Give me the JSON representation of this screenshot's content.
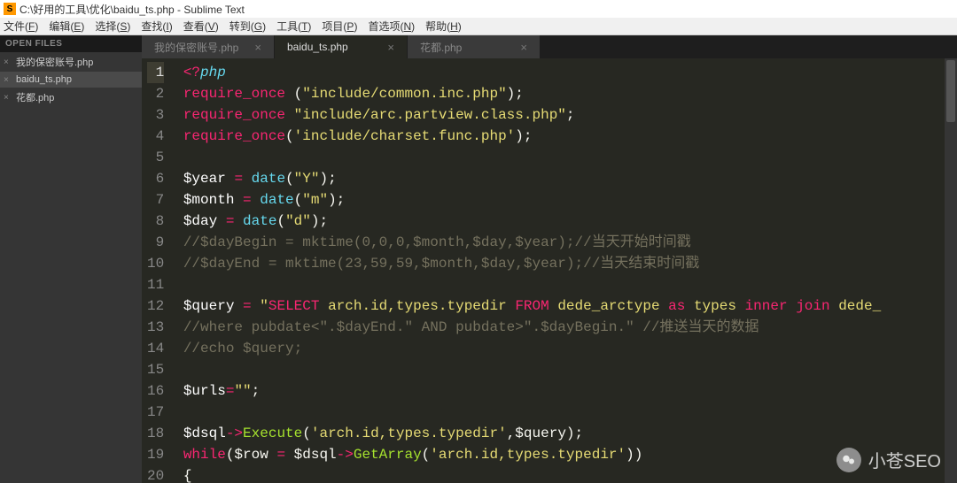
{
  "title": "C:\\好用的工具\\优化\\baidu_ts.php - Sublime Text",
  "menu": [
    "文件(F)",
    "编辑(E)",
    "选择(S)",
    "查找(I)",
    "查看(V)",
    "转到(G)",
    "工具(T)",
    "项目(P)",
    "首选项(N)",
    "帮助(H)"
  ],
  "sidebar": {
    "header": "OPEN FILES",
    "items": [
      {
        "label": "我的保密账号.php",
        "active": false
      },
      {
        "label": "baidu_ts.php",
        "active": true
      },
      {
        "label": "花都.php",
        "active": false
      }
    ]
  },
  "tabs": [
    {
      "label": "我的保密账号.php",
      "active": false
    },
    {
      "label": "baidu_ts.php",
      "active": true
    },
    {
      "label": "花都.php",
      "active": false
    }
  ],
  "code": {
    "start": 1,
    "active": 1,
    "lines": [
      [
        " ",
        [
          "<?",
          "kw2"
        ],
        [
          "php",
          "kw"
        ]
      ],
      [
        " ",
        [
          "require_once",
          "kw2"
        ],
        [
          " (",
          "paren"
        ],
        [
          "\"include/common.inc.php\"",
          "str"
        ],
        [
          ");",
          "paren"
        ]
      ],
      [
        " ",
        [
          "require_once",
          "kw2"
        ],
        [
          " ",
          "paren"
        ],
        [
          "\"include/arc.partview.class.php\"",
          "str"
        ],
        [
          ";",
          "paren"
        ]
      ],
      [
        " ",
        [
          "require_once",
          "kw2"
        ],
        [
          "(",
          "paren"
        ],
        [
          "'include/charset.func.php'",
          "str"
        ],
        [
          ");",
          "paren"
        ]
      ],
      [
        ""
      ],
      [
        " ",
        [
          "$year",
          "var"
        ],
        [
          " ",
          "paren"
        ],
        [
          "=",
          "kw2"
        ],
        [
          " ",
          "paren"
        ],
        [
          "date",
          "fn"
        ],
        [
          "(",
          "paren"
        ],
        [
          "\"Y\"",
          "str"
        ],
        [
          ");",
          "paren"
        ]
      ],
      [
        " ",
        [
          "$month",
          "var"
        ],
        [
          " ",
          "paren"
        ],
        [
          "=",
          "kw2"
        ],
        [
          " ",
          "paren"
        ],
        [
          "date",
          "fn"
        ],
        [
          "(",
          "paren"
        ],
        [
          "\"m\"",
          "str"
        ],
        [
          ");",
          "paren"
        ]
      ],
      [
        " ",
        [
          "$day",
          "var"
        ],
        [
          " ",
          "paren"
        ],
        [
          "=",
          "kw2"
        ],
        [
          " ",
          "paren"
        ],
        [
          "date",
          "fn"
        ],
        [
          "(",
          "paren"
        ],
        [
          "\"d\"",
          "str"
        ],
        [
          ");",
          "paren"
        ]
      ],
      [
        " ",
        [
          "//$dayBegin = mktime(0,0,0,$month,$day,$year);//当天开始时间戳",
          "comment"
        ]
      ],
      [
        " ",
        [
          "//$dayEnd = mktime(23,59,59,$month,$day,$year);//当天结束时间戳",
          "comment"
        ]
      ],
      [
        ""
      ],
      [
        " ",
        [
          "$query",
          "var"
        ],
        [
          " ",
          "paren"
        ],
        [
          "=",
          "kw2"
        ],
        [
          " ",
          "paren"
        ],
        [
          "\"",
          "str"
        ],
        [
          "SELECT",
          "kw2"
        ],
        [
          " arch.id,types.typedir ",
          "str"
        ],
        [
          "FROM",
          "kw2"
        ],
        [
          " dede_arctype ",
          "str"
        ],
        [
          "as",
          "kw2"
        ],
        [
          " types ",
          "str"
        ],
        [
          "inner",
          "kw2"
        ],
        [
          " ",
          "str"
        ],
        [
          "join",
          "kw2"
        ],
        [
          " dede_",
          "str"
        ]
      ],
      [
        " ",
        [
          "//where pubdate<\".$dayEnd.\" AND pubdate>\".$dayBegin.\" //推送当天的数据",
          "comment"
        ]
      ],
      [
        " ",
        [
          "//echo $query;",
          "comment"
        ]
      ],
      [
        ""
      ],
      [
        " ",
        [
          "$urls",
          "var"
        ],
        [
          "=",
          "kw2"
        ],
        [
          "\"\"",
          "str"
        ],
        [
          ";",
          "paren"
        ]
      ],
      [
        ""
      ],
      [
        " ",
        [
          "$dsql",
          "var"
        ],
        [
          "->",
          "kw2"
        ],
        [
          "Execute",
          "fn2"
        ],
        [
          "(",
          "paren"
        ],
        [
          "'arch.id,types.typedir'",
          "str"
        ],
        [
          ",$query);",
          "paren"
        ]
      ],
      [
        " ",
        [
          "while",
          "kw2"
        ],
        [
          "($row ",
          "paren"
        ],
        [
          "=",
          "kw2"
        ],
        [
          " $dsql",
          "paren"
        ],
        [
          "->",
          "kw2"
        ],
        [
          "GetArray",
          "fn2"
        ],
        [
          "(",
          "paren"
        ],
        [
          "'arch.id,types.typedir'",
          "str"
        ],
        [
          "))",
          "paren"
        ]
      ],
      [
        " ",
        [
          "{",
          "paren"
        ]
      ]
    ]
  },
  "watermark": "小苍SEO"
}
